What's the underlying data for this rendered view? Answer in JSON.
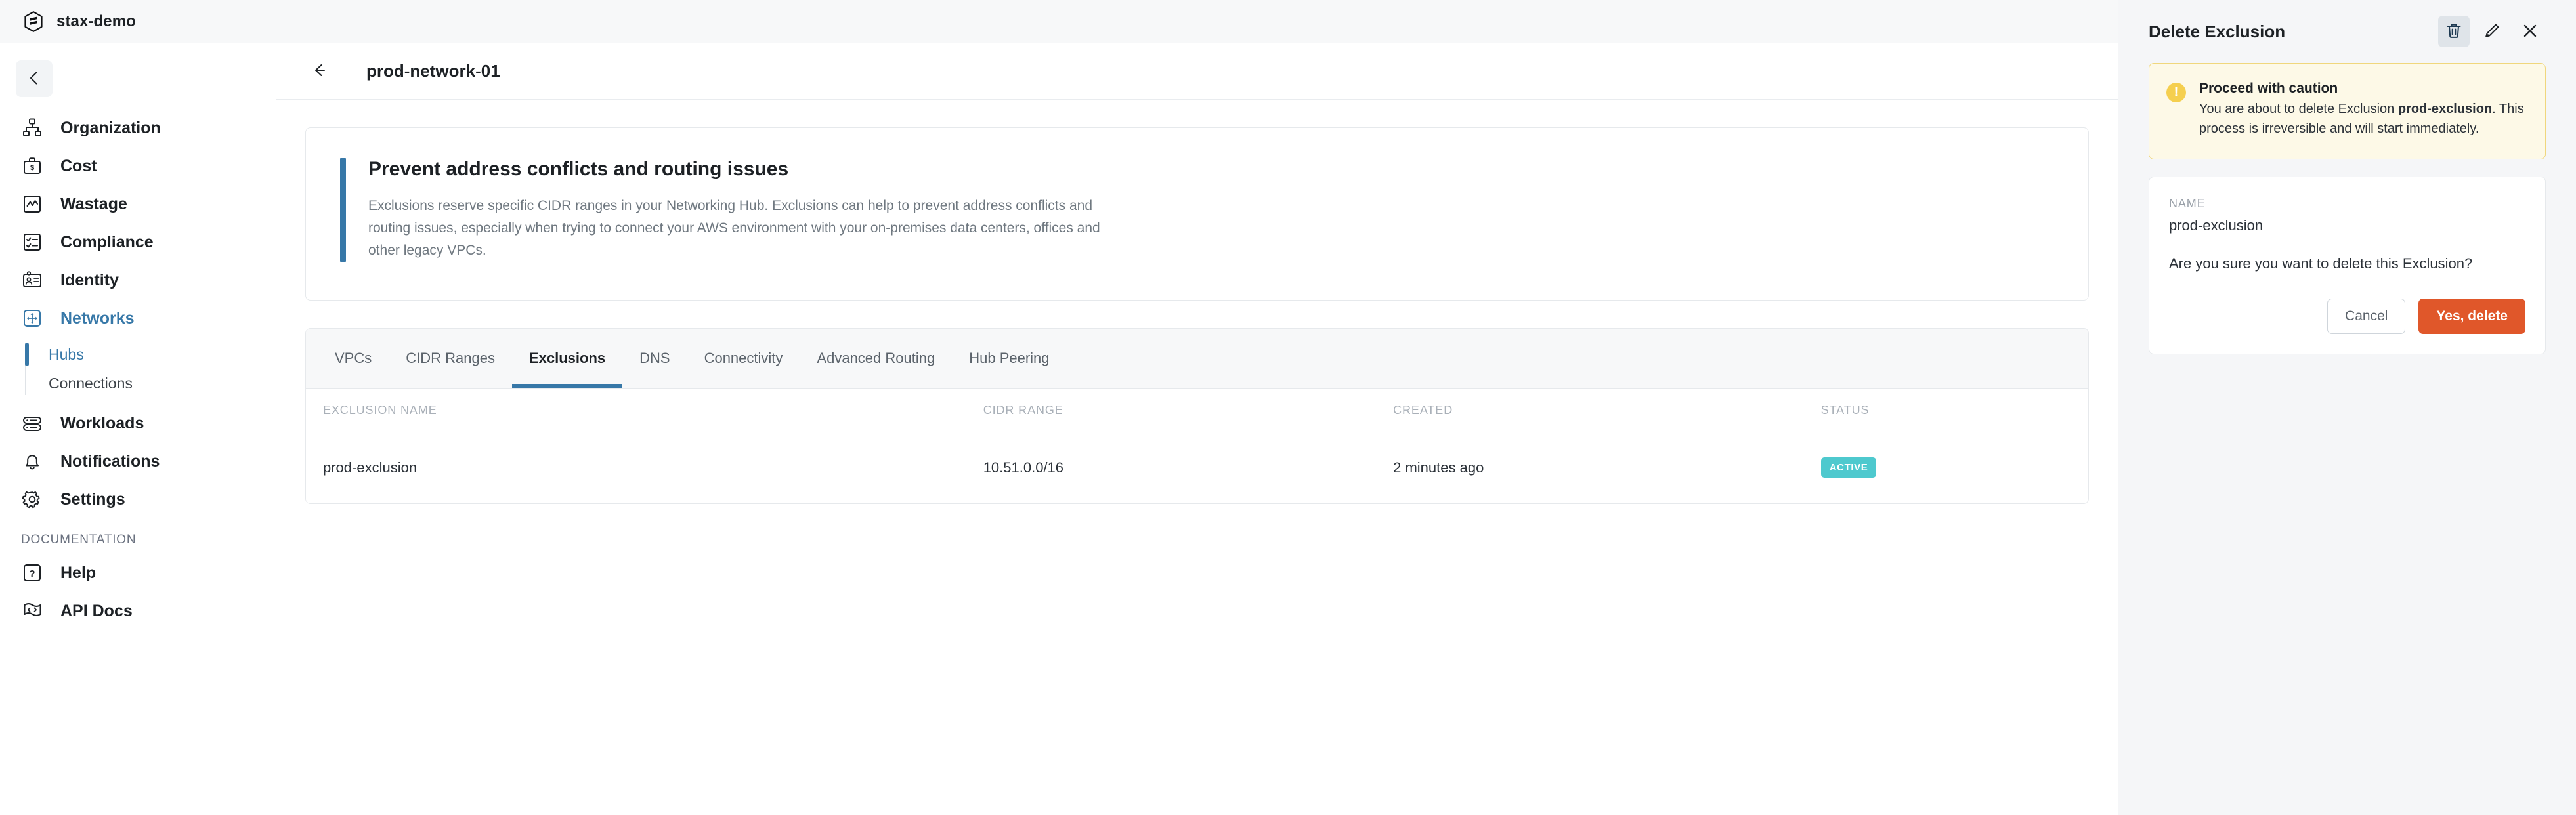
{
  "topbar": {
    "logo_icon": "stax-hex-logo-icon",
    "org_name": "stax-demo"
  },
  "sidebar": {
    "collapse_icon": "chevron-left-icon",
    "items": [
      {
        "label": "Organization",
        "icon": "org-chart-icon",
        "active": false
      },
      {
        "label": "Cost",
        "icon": "briefcase-dollar-icon",
        "active": false
      },
      {
        "label": "Wastage",
        "icon": "chart-line-box-icon",
        "active": false
      },
      {
        "label": "Compliance",
        "icon": "checklist-icon",
        "active": false
      },
      {
        "label": "Identity",
        "icon": "id-badge-icon",
        "active": false
      },
      {
        "label": "Networks",
        "icon": "move-arrows-box-icon",
        "active": true
      },
      {
        "label": "Workloads",
        "icon": "server-stack-icon",
        "active": false
      },
      {
        "label": "Notifications",
        "icon": "bell-icon",
        "active": false
      },
      {
        "label": "Settings",
        "icon": "gear-icon",
        "active": false
      }
    ],
    "networks_subitems": [
      {
        "label": "Hubs",
        "active": true
      },
      {
        "label": "Connections",
        "active": false
      }
    ],
    "documentation_label": "DOCUMENTATION",
    "documentation_items": [
      {
        "label": "Help",
        "icon": "question-box-icon"
      },
      {
        "label": "API Docs",
        "icon": "code-flag-icon"
      }
    ]
  },
  "main": {
    "back_icon": "arrow-left-icon",
    "page_title": "prod-network-01",
    "info": {
      "title": "Prevent address conflicts and routing issues",
      "description": "Exclusions reserve specific CIDR ranges in your Networking Hub. Exclusions can help to prevent address conflicts and routing issues, especially when trying to connect your AWS environment with your on-premises data centers, offices and other legacy VPCs.",
      "accent_color": "#3778a8"
    },
    "tabs": [
      {
        "label": "VPCs",
        "active": false
      },
      {
        "label": "CIDR Ranges",
        "active": false
      },
      {
        "label": "Exclusions",
        "active": true
      },
      {
        "label": "DNS",
        "active": false
      },
      {
        "label": "Connectivity",
        "active": false
      },
      {
        "label": "Advanced Routing",
        "active": false
      },
      {
        "label": "Hub Peering",
        "active": false
      }
    ],
    "table": {
      "columns": [
        "EXCLUSION NAME",
        "CIDR RANGE",
        "CREATED",
        "STATUS"
      ],
      "rows": [
        {
          "name": "prod-exclusion",
          "cidr": "10.51.0.0/16",
          "created": "2 minutes ago",
          "status": "ACTIVE",
          "status_color": "#4ec9ce"
        }
      ]
    }
  },
  "panel": {
    "title": "Delete Exclusion",
    "actions": [
      {
        "icon": "trash-icon",
        "name": "delete-exclusion-icon-button",
        "highlighted": true
      },
      {
        "icon": "pencil-icon",
        "name": "edit-exclusion-icon-button",
        "highlighted": false
      },
      {
        "icon": "close-icon",
        "name": "close-panel-icon-button",
        "highlighted": false
      }
    ],
    "alert": {
      "icon": "warning-exclamation-icon",
      "title": "Proceed with caution",
      "text_before": "You are about to delete Exclusion ",
      "text_bold": "prod-exclusion",
      "text_after": ". This process is irreversible and will start immediately.",
      "bg_color": "#fdf9e7",
      "border_color": "#f0d77d",
      "icon_color": "#f5cf4e"
    },
    "form": {
      "name_label": "NAME",
      "name_value": "prod-exclusion",
      "confirm_question": "Are you sure you want to delete this Exclusion?",
      "cancel_label": "Cancel",
      "confirm_label": "Yes, delete",
      "confirm_color": "#e0572a"
    }
  }
}
